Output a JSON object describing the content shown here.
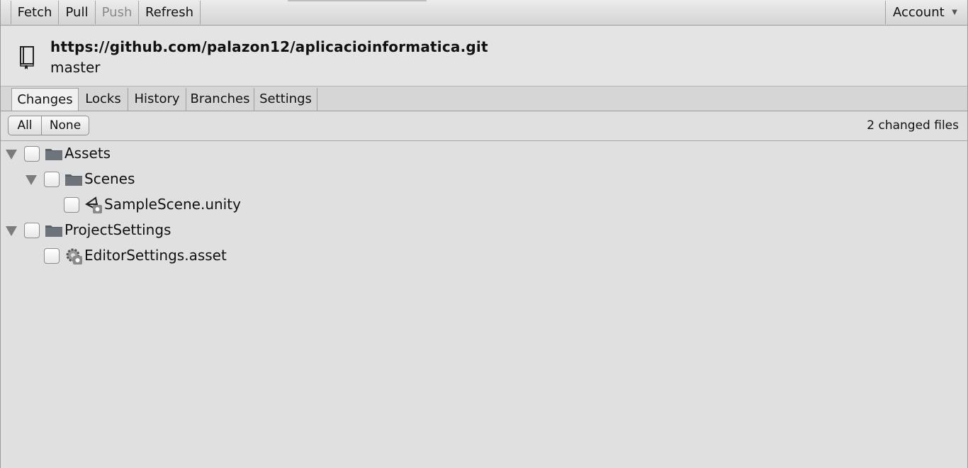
{
  "toolbar": {
    "fetch": "Fetch",
    "pull": "Pull",
    "push": "Push",
    "refresh": "Refresh",
    "account": "Account",
    "account_caret": "▼"
  },
  "repo": {
    "url": "https://github.com/palazon12/aplicacioinformatica.git",
    "branch": "master",
    "icon": "book-icon"
  },
  "tabs": [
    {
      "label": "Changes",
      "active": true
    },
    {
      "label": "Locks",
      "active": false
    },
    {
      "label": "History",
      "active": false
    },
    {
      "label": "Branches",
      "active": false
    },
    {
      "label": "Settings",
      "active": false
    }
  ],
  "selection": {
    "all": "All",
    "none": "None",
    "changed_files": "2 changed files"
  },
  "tree": [
    {
      "label": "Assets",
      "type": "folder",
      "expanded": true,
      "checked": false
    },
    {
      "label": "Scenes",
      "type": "folder",
      "expanded": true,
      "checked": false
    },
    {
      "label": "SampleScene.unity",
      "type": "scene-file",
      "checked": false
    },
    {
      "label": "ProjectSettings",
      "type": "folder",
      "expanded": true,
      "checked": false
    },
    {
      "label": "EditorSettings.asset",
      "type": "settings-asset",
      "checked": false
    }
  ],
  "colors": {
    "background": "#e0e0e0",
    "disabled_text": "#8a8a8a",
    "folder": "#5a6068"
  }
}
